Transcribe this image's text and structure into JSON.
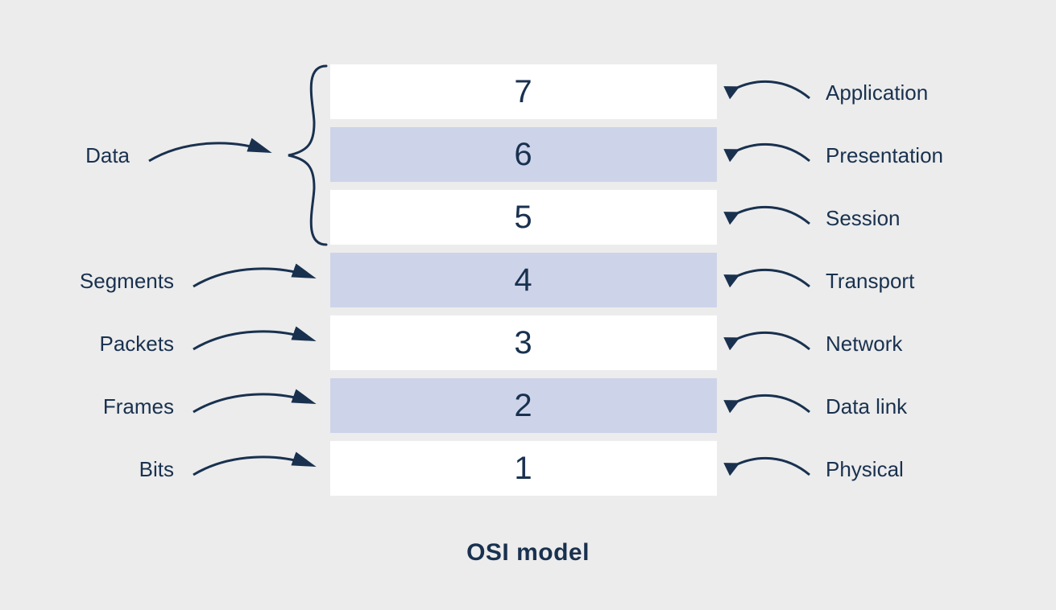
{
  "title": "OSI model",
  "colors": {
    "text": "#19314f",
    "bg": "#ececec",
    "row_white": "#ffffff",
    "row_alt": "#cdd4e9"
  },
  "layers": [
    {
      "number": "7",
      "name": "Application",
      "alt": false
    },
    {
      "number": "6",
      "name": "Presentation",
      "alt": true
    },
    {
      "number": "5",
      "name": "Session",
      "alt": false
    },
    {
      "number": "4",
      "name": "Transport",
      "alt": true
    },
    {
      "number": "3",
      "name": "Network",
      "alt": false
    },
    {
      "number": "2",
      "name": "Data link",
      "alt": true
    },
    {
      "number": "1",
      "name": "Physical",
      "alt": false
    }
  ],
  "data_units": [
    {
      "label": "Data",
      "covers_layers": [
        "7",
        "6",
        "5"
      ]
    },
    {
      "label": "Segments",
      "covers_layers": [
        "4"
      ]
    },
    {
      "label": "Packets",
      "covers_layers": [
        "3"
      ]
    },
    {
      "label": "Frames",
      "covers_layers": [
        "2"
      ]
    },
    {
      "label": "Bits",
      "covers_layers": [
        "1"
      ]
    }
  ]
}
